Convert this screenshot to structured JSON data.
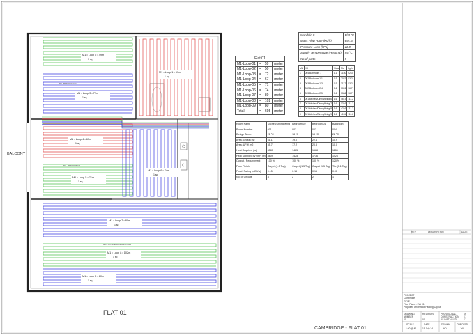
{
  "drawing": {
    "floor_label": "FLAT 01",
    "sheet_label": "CAMBRIDGE - FLAT 01",
    "balcony_label": "BALCONY"
  },
  "loops": [
    {
      "label": "M1 • Loop 2 • 49m",
      "area": "1 sq",
      "color": "#4ec04e"
    },
    {
      "label": "M1 • Loop 3 • 72m",
      "area": "1 sq",
      "color": "#3a3adf"
    },
    {
      "label": "M1 • Loop 1 • 59m",
      "area": "1 sq",
      "color": "#e04848"
    },
    {
      "label": "M1 • Loop 4 • 67m",
      "area": "1 sq",
      "color": "#e04848"
    },
    {
      "label": "M1 • Loop 5 • 71m",
      "area": "1 sq",
      "color": "#4ec04e"
    },
    {
      "label": "M1 • Loop 6 • 74m",
      "area": "1 sq",
      "color": "#3a3adf"
    },
    {
      "label": "M1 • Loop 7 • 80m",
      "area": "1 sq",
      "color": "#3a3adf"
    },
    {
      "label": "M1 • Loop 8 • 102m",
      "area": "1 sq",
      "color": "#4ec04e"
    },
    {
      "label": "M1 • Loop 9 • 80m",
      "area": "1 sq",
      "color": "#3a3adf"
    }
  ],
  "room_tags": [
    "002 - BEDROOM 02",
    "003 - BEDROOM 01",
    "001 - KITCHEN/DINING/LIVING"
  ],
  "lengths_table": {
    "caption": "Flat 01",
    "rows": [
      [
        "M1-Loop-01",
        "=",
        "59",
        "meter"
      ],
      [
        "M1-Loop-02",
        "=",
        "50",
        "meter"
      ],
      [
        "M1-Loop-03",
        "=",
        "72",
        "meter"
      ],
      [
        "M1-Loop-04",
        "=",
        "67",
        "meter"
      ],
      [
        "M1-Loop-05",
        "=",
        "71",
        "meter"
      ],
      [
        "M1-Loop-06",
        "=",
        "74",
        "meter"
      ],
      [
        "M1-Loop-07",
        "=",
        "80",
        "meter"
      ],
      [
        "M1-Loop-08",
        "=",
        "102",
        "meter"
      ],
      [
        "M1-Loop-09",
        "=",
        "80",
        "meter"
      ],
      [
        "Total",
        "=",
        "695",
        "meter"
      ]
    ]
  },
  "manifold_table": {
    "rows": [
      [
        "Manifold #",
        "Flat 01"
      ],
      [
        "Mass Flow Rate (Kg/h)",
        "691.6"
      ],
      [
        "Pressure Loss (kPa)",
        "11.0"
      ],
      [
        "Supply Temperature (Heating)",
        "55 °C"
      ],
      [
        "No of ports",
        "9"
      ]
    ]
  },
  "room_table": {
    "rows": [
      [
        "Room Name",
        "Kitchen/Dining/living",
        "Bedroom 02",
        "Bedroom 01",
        "Bathroom"
      ],
      [
        "Room Number",
        "001",
        "002",
        "003",
        "004"
      ],
      [
        "Design Temp.",
        "21 °C",
        "18 °C",
        "18 °C",
        "22 °C"
      ],
      [
        "Area (Gross) m2",
        "61.1",
        "19.0",
        "22.4",
        "10.9"
      ],
      [
        "Area (UFH) m2",
        "55.7",
        "17.2",
        "20.3",
        "10.0"
      ],
      [
        "Heat Required (w)",
        "4580",
        "1425",
        "1668",
        "1183"
      ],
      [
        "Heat Supplied by UFH (w)",
        "4609",
        "1425",
        "1736",
        "1426"
      ],
      [
        "Output / Requirement",
        "100 %",
        "100 %",
        "100 %",
        "120 %"
      ],
      [
        "Floor Finish",
        "Carpet (1.5 Tog)",
        "Carpet (1.5 Tog)",
        "Carpet (1.5 Tog)",
        "Tile (0.1 Tog)"
      ],
      [
        "Finish Rating (m2K/w)",
        "0.15",
        "0.15",
        "0.15",
        "0.01"
      ],
      [
        "No. of Circuits",
        "4",
        "2",
        "2",
        "1"
      ]
    ]
  },
  "outputs_table": {
    "rows": [
      [
        "ML",
        "HK",
        "View",
        "Flo",
        "kg/h"
      ],
      [
        "1",
        "004 Bathroom 1",
        "1.1",
        "3150",
        "62.3"
      ],
      [
        "2",
        "002 Bedroom 1 1",
        "0.9",
        "2037",
        "53.2"
      ],
      [
        "3",
        "003 Bedroom 1 3",
        "0.9",
        "3117",
        "53.2"
      ],
      [
        "4",
        "002 Bedroom 2 4",
        "0.6",
        "1026",
        "36.7"
      ],
      [
        "5",
        "003 Bedroom 2 5",
        "0.6",
        "1086",
        "36.7"
      ],
      [
        "6",
        "001 kitchen/Dining/living 6",
        "1.6",
        "4673",
        "111.2"
      ],
      [
        "7",
        "001 kitchen/Dining/living 7",
        "1.6",
        "1316",
        "111.2"
      ],
      [
        "8",
        "001 kitchen/Dining/living 8",
        "1.6",
        "4216",
        "111.2"
      ],
      [
        "9",
        "001 kitchen/Dining/living 9",
        "1.6",
        "4116",
        "111.2"
      ]
    ]
  },
  "title_block": {
    "revision_headers": [
      "REV",
      "DESCRIPTION",
      "DATE"
    ],
    "project_label": "PROJECT",
    "project": "Cambridge",
    "title_label": "TITLE",
    "title_line1": "Floor Plans - Flat 01",
    "title_line2": "Proposed Underfloor Heating Layout",
    "drawing_number_label": "DRAWING NUMBER",
    "drawing_number": "00",
    "revision_label": "REVISION",
    "revision": "00",
    "status_lines": [
      "PROVISIONAL",
      "CONSTRUCTION",
      "AS INSTALLED"
    ],
    "status_marks": [
      "☒",
      "☐",
      "☐"
    ],
    "scale_label": "SCALE",
    "scale": "1:50 @ A1",
    "date_label": "DATE",
    "date": "15 July 24",
    "drawn_label": "DRAWN",
    "drawn": "HD",
    "checked_label": "CHECKED",
    "checked": "JW"
  }
}
